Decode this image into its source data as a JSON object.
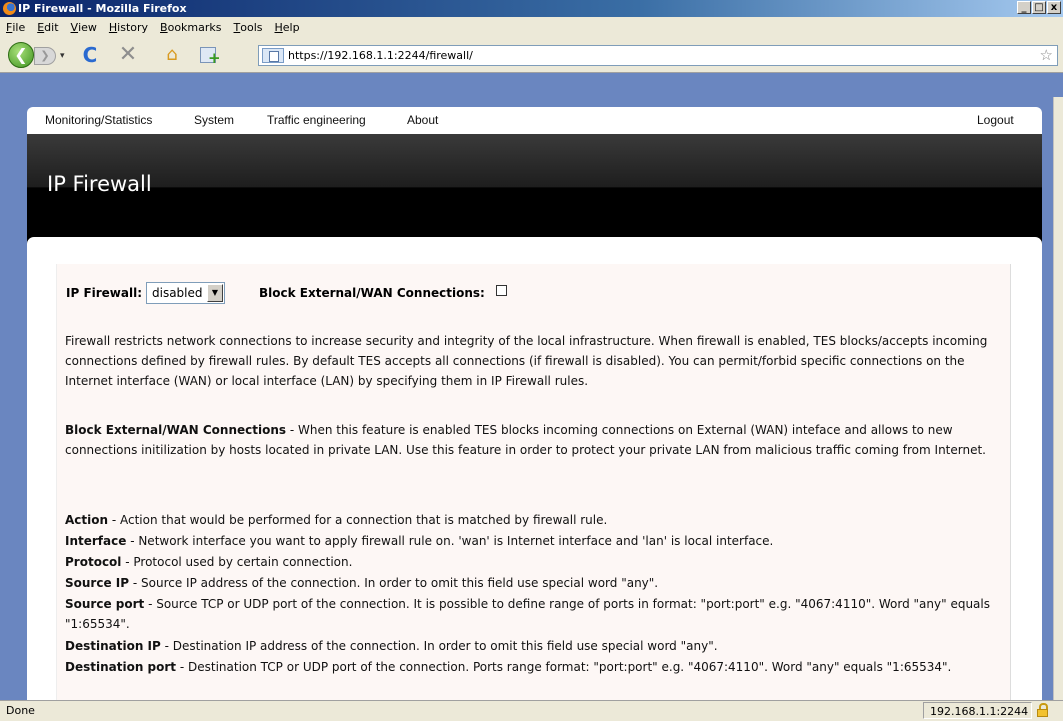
{
  "window": {
    "title": "IP Firewall - Mozilla Firefox",
    "min_glyph": "_",
    "max_glyph": "□",
    "close_glyph": "x"
  },
  "menubar": {
    "items": [
      "File",
      "Edit",
      "View",
      "History",
      "Bookmarks",
      "Tools",
      "Help"
    ]
  },
  "navbar": {
    "url": "https://192.168.1.1:2244/firewall/",
    "back_glyph": "❮",
    "fwd_glyph": "❯",
    "history_glyph": "▾",
    "reload_glyph": "C",
    "stop_glyph": "✕",
    "home_glyph": "⌂",
    "star_glyph": "☆"
  },
  "site_nav": {
    "items": [
      "Monitoring/Statistics",
      "System",
      "Traffic engineering",
      "About"
    ],
    "logout": "Logout"
  },
  "page": {
    "title": "IP Firewall",
    "fw_label": "IP Firewall:",
    "fw_value": "disabled",
    "fw_arrow": "▼",
    "block_label": "Block External/WAN Connections:",
    "block_checked": false,
    "intro": "Firewall restricts network connections to increase security and integrity of the local infrastructure. When firewall is enabled, TES blocks/accepts incoming connections defined by firewall rules. By default TES accepts all connections (if firewall is disabled). You can permit/forbid specific connections on the Internet interface (WAN) or local interface (LAN) by specifying them in IP Firewall rules.",
    "block_desc_term": "Block External/WAN Connections",
    "block_desc": " - When this feature is enabled TES blocks incoming connections on External (WAN) inteface and allows to new connections initilization by hosts located in private LAN. Use this feature in order to protect your private LAN from malicious traffic coming from Internet.",
    "definitions": [
      {
        "term": "Action",
        "text": " - Action that would be performed for a connection that is matched by firewall rule."
      },
      {
        "term": "Interface",
        "text": " - Network interface you want to apply firewall rule on. 'wan' is Internet interface and 'lan' is local interface."
      },
      {
        "term": "Protocol",
        "text": " - Protocol used by certain connection."
      },
      {
        "term": "Source IP",
        "text": " - Source IP address of the connection. In order to omit this field use special word \"any\"."
      },
      {
        "term": "Source port",
        "text": " - Source TCP or UDP port of the connection. It is possible to define range of ports in format: \"port:port\" e.g. \"4067:4110\". Word \"any\" equals \"1:65534\"."
      },
      {
        "term": "Destination IP",
        "text": " - Destination IP address of the connection. In order to omit this field use special word \"any\"."
      },
      {
        "term": "Destination port",
        "text": " - Destination TCP or UDP port of the connection. Ports range format: \"port:port\" e.g. \"4067:4110\". Word \"any\" equals \"1:65534\"."
      }
    ]
  },
  "statusbar": {
    "status": "Done",
    "host": "192.168.1.1:2244"
  }
}
